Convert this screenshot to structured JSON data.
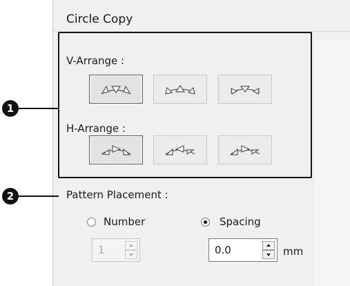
{
  "dialog": {
    "title": "Circle Copy"
  },
  "callouts": {
    "arrange": "1",
    "placement": "2"
  },
  "v_arrange": {
    "label": "V-Arrange :",
    "options": [
      {
        "icon": "v-arrange-outward-icon",
        "selected": true
      },
      {
        "icon": "v-arrange-inward-icon",
        "selected": false
      },
      {
        "icon": "v-arrange-rotated-icon",
        "selected": false
      }
    ]
  },
  "h_arrange": {
    "label": "H-Arrange :",
    "options": [
      {
        "icon": "h-arrange-clockwise-icon",
        "selected": true
      },
      {
        "icon": "h-arrange-counterclockwise-icon",
        "selected": false
      },
      {
        "icon": "h-arrange-alternate-icon",
        "selected": false
      }
    ]
  },
  "placement": {
    "label": "Pattern Placement :",
    "number": {
      "label": "Number",
      "value": "1",
      "selected": false,
      "enabled": false
    },
    "spacing": {
      "label": "Spacing",
      "value": "0.0",
      "unit": "mm",
      "selected": true,
      "enabled": true
    }
  },
  "colors": {
    "panel": "#f0f0f0",
    "frame": "#141414",
    "icon": "#555555"
  }
}
